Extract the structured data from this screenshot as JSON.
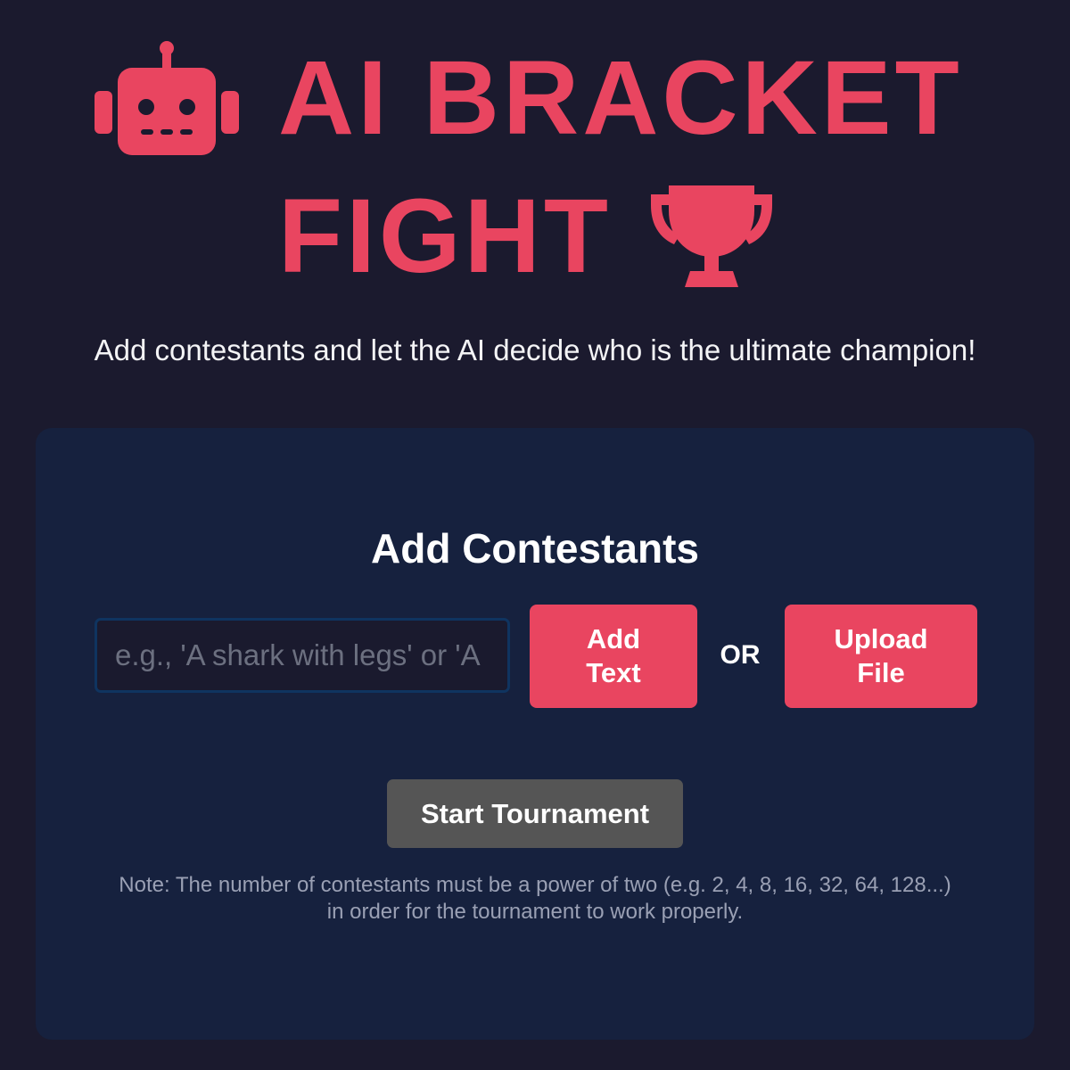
{
  "header": {
    "title_line1": "AI BRACKET",
    "title_line2": "FIGHT",
    "robot_icon": "robot-icon",
    "trophy_icon": "trophy-icon",
    "subtitle": "Add contestants and let the AI decide who is the ultimate champion!"
  },
  "card": {
    "title": "Add Contestants",
    "input_placeholder": "e.g., 'A shark with legs' or 'A",
    "input_value": "",
    "add_button_label": "Add Text",
    "or_label": "OR",
    "upload_button_label": "Upload File",
    "start_button_label": "Start Tournament",
    "note_line1": "Note: The number of contestants must be a power of two (e.g. 2, 4, 8, 16, 32, 64, 128...)",
    "note_line2": "in order for the tournament to work properly."
  },
  "colors": {
    "background": "#1b1a2e",
    "accent": "#e94560",
    "card": "#16213e",
    "start_button": "#555555"
  }
}
